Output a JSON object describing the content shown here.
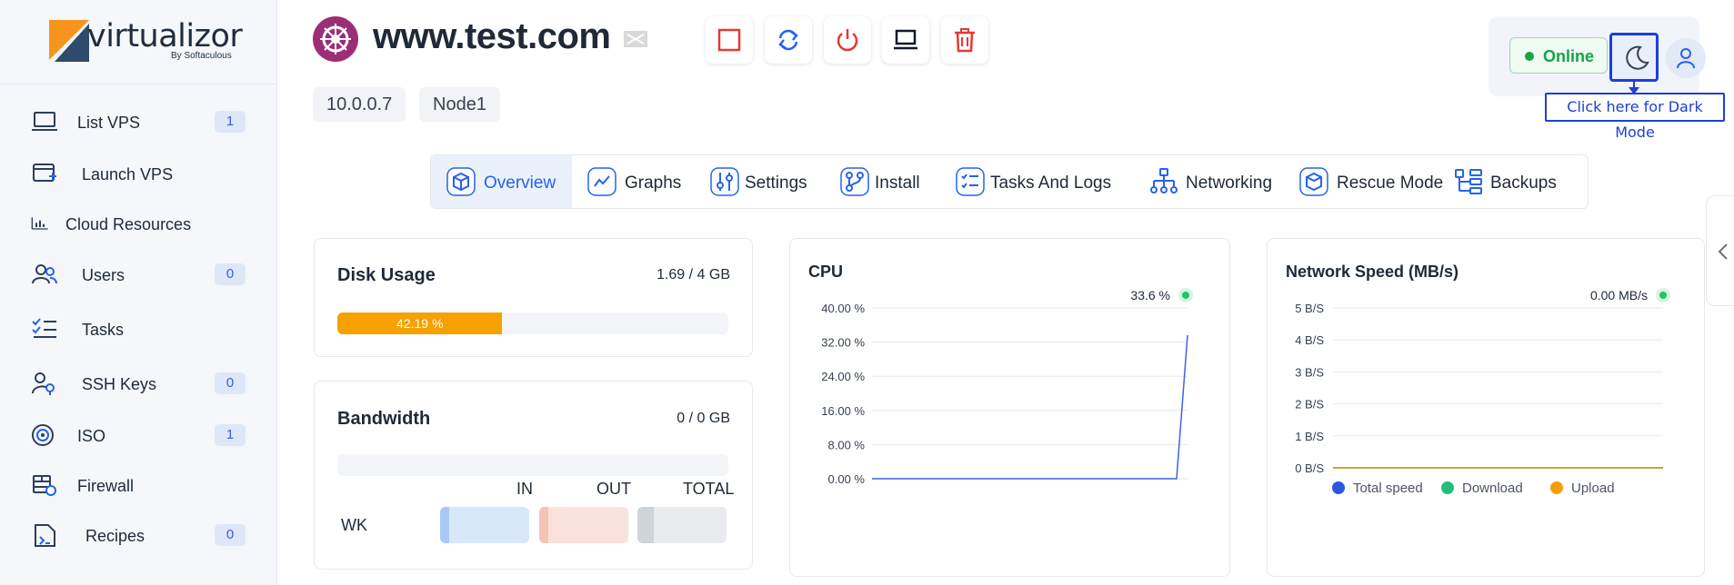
{
  "brand": {
    "name": "virtualizor",
    "byline": "By Softaculous"
  },
  "sidebar": {
    "items": [
      {
        "label": "List VPS",
        "badge": "1",
        "icon": "laptop-icon"
      },
      {
        "label": "Launch VPS",
        "badge": null,
        "icon": "add-window-icon"
      },
      {
        "label": "Cloud Resources",
        "badge": null,
        "icon": "bar-chart-icon"
      },
      {
        "label": "Users",
        "badge": "0",
        "icon": "users-icon"
      },
      {
        "label": "Tasks",
        "badge": null,
        "icon": "task-list-icon"
      },
      {
        "label": "SSH Keys",
        "badge": "0",
        "icon": "user-key-icon"
      },
      {
        "label": "ISO",
        "badge": "1",
        "icon": "disc-icon"
      },
      {
        "label": "Firewall",
        "badge": null,
        "icon": "firewall-icon"
      },
      {
        "label": "Recipes",
        "badge": "0",
        "icon": "recipe-file-icon"
      }
    ]
  },
  "header": {
    "hostname": "www.test.com",
    "ip": "10.0.0.7",
    "node": "Node1",
    "actions": [
      "stop-icon",
      "restart-icon",
      "power-icon",
      "vnc-console-icon",
      "delete-icon"
    ]
  },
  "status": {
    "label": "Online",
    "color": "#17a34a"
  },
  "tooltip": "Click here for Dark Mode",
  "tabs": [
    {
      "label": "Overview",
      "icon": "cube-icon",
      "active": true
    },
    {
      "label": "Graphs",
      "icon": "graph-icon",
      "active": false
    },
    {
      "label": "Settings",
      "icon": "sliders-icon",
      "active": false
    },
    {
      "label": "Install",
      "icon": "install-icon",
      "active": false
    },
    {
      "label": "Tasks And Logs",
      "icon": "checklist-icon",
      "active": false
    },
    {
      "label": "Networking",
      "icon": "network-icon",
      "active": false
    },
    {
      "label": "Rescue Mode",
      "icon": "rescue-icon",
      "active": false
    },
    {
      "label": "Backups",
      "icon": "backups-icon",
      "active": false
    }
  ],
  "disk": {
    "title": "Disk Usage",
    "value": "1.69 / 4 GB",
    "percent_label": "42.19 %",
    "percent": 42.19,
    "color": "#f6a100"
  },
  "bandwidth": {
    "title": "Bandwidth",
    "value": "0 / 0 GB",
    "headers": [
      "IN",
      "OUT",
      "TOTAL"
    ],
    "row_label": "WK"
  },
  "cpu": {
    "title": "CPU",
    "current": "33.6 %",
    "chart_data": {
      "type": "line",
      "ylim": [
        0,
        40
      ],
      "yticks": [
        "40.00 %",
        "32.00 %",
        "24.00 %",
        "16.00 %",
        "8.00 %",
        "0.00 %"
      ],
      "series": [
        {
          "values": [
            0,
            0,
            0,
            0,
            0,
            0,
            0,
            0,
            0,
            0,
            0,
            0,
            0,
            0,
            0,
            0,
            0,
            0,
            0,
            0,
            0,
            0,
            0,
            0,
            0,
            0,
            0,
            0,
            0,
            33.6
          ],
          "color": "#3b63e6"
        }
      ]
    }
  },
  "network": {
    "title": "Network Speed (MB/s)",
    "current": "0.00 MB/s",
    "chart_data": {
      "type": "line",
      "ylim": [
        0,
        5
      ],
      "yticks": [
        "5 B/S",
        "4 B/S",
        "3 B/S",
        "2 B/S",
        "1 B/S",
        "0 B/S"
      ],
      "series": [
        {
          "name": "Total speed",
          "color": "#2f55e4",
          "values": [
            0,
            0,
            0,
            0,
            0,
            0,
            0,
            0,
            0,
            0
          ]
        },
        {
          "name": "Download",
          "color": "#1fbf7a",
          "values": [
            0,
            0,
            0,
            0,
            0,
            0,
            0,
            0,
            0,
            0
          ]
        },
        {
          "name": "Upload",
          "color": "#f59e0b",
          "values": [
            0,
            0,
            0,
            0,
            0,
            0,
            0,
            0,
            0,
            0
          ]
        }
      ]
    }
  }
}
